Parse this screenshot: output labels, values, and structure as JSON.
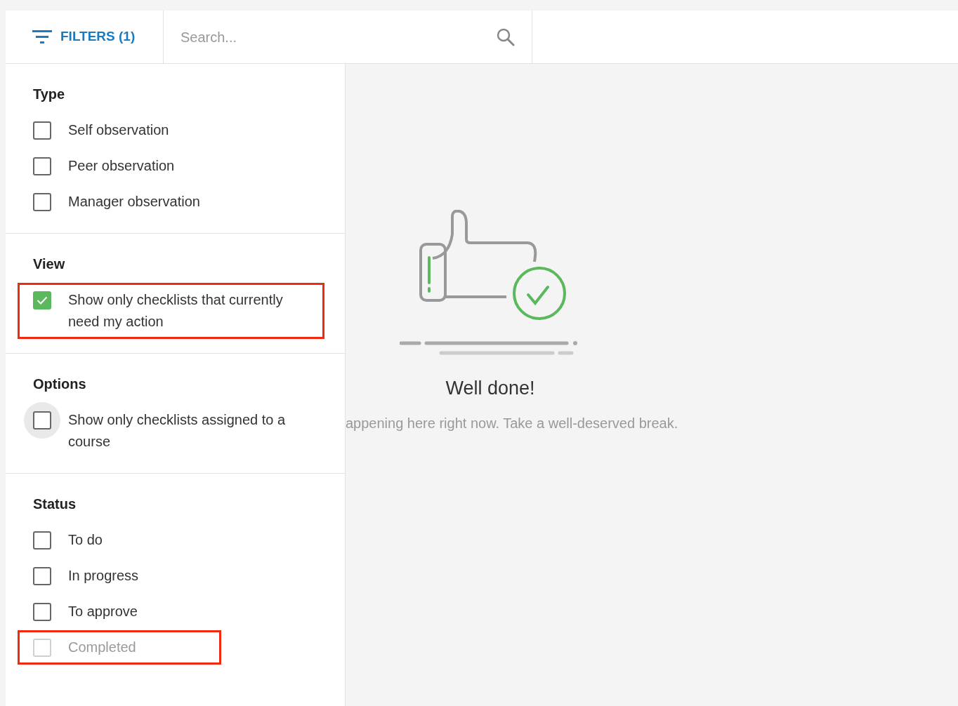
{
  "header": {
    "filter_button": {
      "label": "FILTERS (1)"
    },
    "search": {
      "placeholder": "Search..."
    }
  },
  "filters": {
    "sections": [
      {
        "title": "Type",
        "options": [
          {
            "label": "Self observation",
            "checked": false,
            "disabled": false,
            "hovered": false,
            "highlighted": false
          },
          {
            "label": "Peer observation",
            "checked": false,
            "disabled": false,
            "hovered": false,
            "highlighted": false
          },
          {
            "label": "Manager observation",
            "checked": false,
            "disabled": false,
            "hovered": false,
            "highlighted": false
          }
        ]
      },
      {
        "title": "View",
        "options": [
          {
            "label": "Show only checklists that currently need my action",
            "checked": true,
            "disabled": false,
            "hovered": false,
            "highlighted": true
          }
        ]
      },
      {
        "title": "Options",
        "options": [
          {
            "label": "Show only checklists assigned to a course",
            "checked": false,
            "disabled": false,
            "hovered": true,
            "highlighted": false
          }
        ]
      },
      {
        "title": "Status",
        "options": [
          {
            "label": "To do",
            "checked": false,
            "disabled": false,
            "hovered": false,
            "highlighted": false
          },
          {
            "label": "In progress",
            "checked": false,
            "disabled": false,
            "hovered": false,
            "highlighted": false
          },
          {
            "label": "To approve",
            "checked": false,
            "disabled": false,
            "hovered": false,
            "highlighted": false
          },
          {
            "label": "Completed",
            "checked": false,
            "disabled": true,
            "hovered": false,
            "highlighted": true
          }
        ]
      }
    ]
  },
  "empty_state": {
    "title": "Well done!",
    "message": "appening here right now. Take a well-deserved break."
  }
}
